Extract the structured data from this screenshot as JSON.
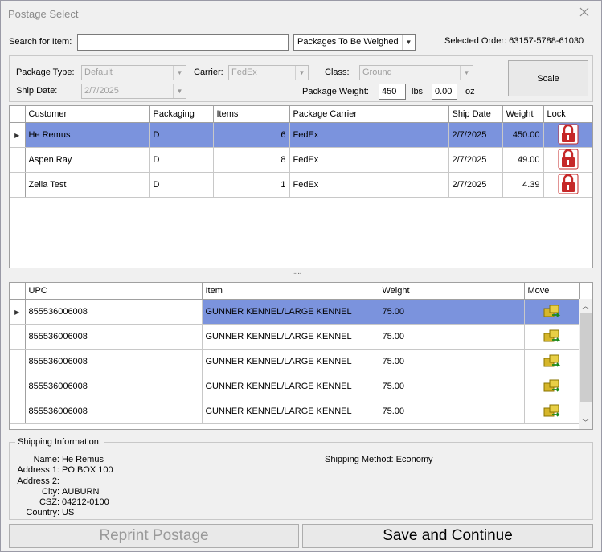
{
  "window": {
    "title": "Postage Select"
  },
  "search": {
    "label": "Search for Item:",
    "value": "",
    "filter": "Packages To Be Weighed"
  },
  "selected_order": "Selected Order: 63157-5788-61030",
  "form": {
    "package_type_label": "Package Type:",
    "package_type": "Default",
    "carrier_label": "Carrier:",
    "carrier": "FedEx",
    "class_label": "Class:",
    "class": "Ground",
    "ship_date_label": "Ship Date:",
    "ship_date": "2/7/2025",
    "weight_label": "Package Weight:",
    "weight_lbs": "450",
    "lbs_label": "lbs",
    "weight_oz": "0.00",
    "oz_label": "oz",
    "scale_button": "Scale"
  },
  "packages": {
    "columns": [
      "Customer",
      "Packaging",
      "Items",
      "Package Carrier",
      "Ship Date",
      "Weight",
      "Lock"
    ],
    "rows": [
      {
        "customer": "He Remus",
        "packaging": "D",
        "items": "6",
        "carrier": "FedEx",
        "ship_date": "2/7/2025",
        "weight": "450.00"
      },
      {
        "customer": "Aspen Ray",
        "packaging": "D",
        "items": "8",
        "carrier": "FedEx",
        "ship_date": "2/7/2025",
        "weight": "49.00"
      },
      {
        "customer": "Zella Test",
        "packaging": "D",
        "items": "1",
        "carrier": "FedEx",
        "ship_date": "2/7/2025",
        "weight": "4.39"
      }
    ],
    "selected_index": 0,
    "lock_icon": "lock-icon"
  },
  "splitter": "·····",
  "items": {
    "columns": [
      "UPC",
      "Item",
      "Weight",
      "Move"
    ],
    "rows": [
      {
        "upc": "855536006008",
        "item": "GUNNER KENNEL/LARGE KENNEL",
        "weight": "75.00"
      },
      {
        "upc": "855536006008",
        "item": "GUNNER KENNEL/LARGE KENNEL",
        "weight": "75.00"
      },
      {
        "upc": "855536006008",
        "item": "GUNNER KENNEL/LARGE KENNEL",
        "weight": "75.00"
      },
      {
        "upc": "855536006008",
        "item": "GUNNER KENNEL/LARGE KENNEL",
        "weight": "75.00"
      },
      {
        "upc": "855536006008",
        "item": "GUNNER KENNEL/LARGE KENNEL",
        "weight": "75.00"
      }
    ],
    "selected_index": 0,
    "move_icon": "move-boxes-icon"
  },
  "shipping": {
    "legend": "Shipping Information:",
    "name_label": "Name:",
    "name": "He Remus",
    "addr1_label": "Address 1:",
    "addr1": "PO BOX 100",
    "addr2_label": "Address 2:",
    "addr2": "",
    "city_label": "City:",
    "city": "AUBURN",
    "csz_label": "CSZ:",
    "csz": "04212-0100",
    "country_label": "Country:",
    "country": "US",
    "method": "Shipping Method: Economy"
  },
  "buttons": {
    "reprint": "Reprint Postage",
    "save": "Save and Continue"
  },
  "colors": {
    "selection": "#7b93dd",
    "lock": "#c62828",
    "move": "#c8a800"
  }
}
